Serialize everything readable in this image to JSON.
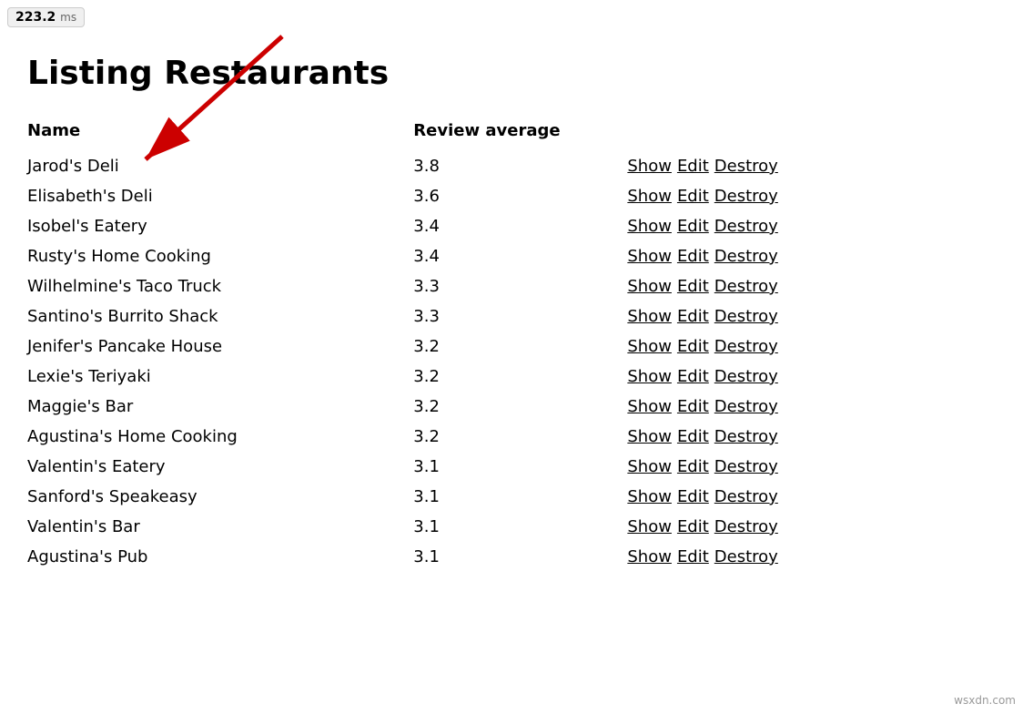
{
  "perf": {
    "value": "223.2",
    "unit": "ms"
  },
  "page": {
    "title": "Listing Restaurants"
  },
  "table": {
    "columns": [
      {
        "key": "name",
        "label": "Name"
      },
      {
        "key": "review_average",
        "label": "Review average"
      },
      {
        "key": "actions",
        "label": ""
      }
    ],
    "rows": [
      {
        "name": "Jarod's Deli",
        "review_average": "3.8"
      },
      {
        "name": "Elisabeth's Deli",
        "review_average": "3.6"
      },
      {
        "name": "Isobel's Eatery",
        "review_average": "3.4"
      },
      {
        "name": "Rusty's Home Cooking",
        "review_average": "3.4"
      },
      {
        "name": "Wilhelmine's Taco Truck",
        "review_average": "3.3"
      },
      {
        "name": "Santino's Burrito Shack",
        "review_average": "3.3"
      },
      {
        "name": "Jenifer's Pancake House",
        "review_average": "3.2"
      },
      {
        "name": "Lexie's Teriyaki",
        "review_average": "3.2"
      },
      {
        "name": "Maggie's Bar",
        "review_average": "3.2"
      },
      {
        "name": "Agustina's Home Cooking",
        "review_average": "3.2"
      },
      {
        "name": "Valentin's Eatery",
        "review_average": "3.1"
      },
      {
        "name": "Sanford's Speakeasy",
        "review_average": "3.1"
      },
      {
        "name": "Valentin's Bar",
        "review_average": "3.1"
      },
      {
        "name": "Agustina's Pub",
        "review_average": "3.1"
      }
    ],
    "actions": {
      "show": "Show",
      "edit": "Edit",
      "destroy": "Destroy"
    }
  },
  "watermark": "wsxdn.com"
}
